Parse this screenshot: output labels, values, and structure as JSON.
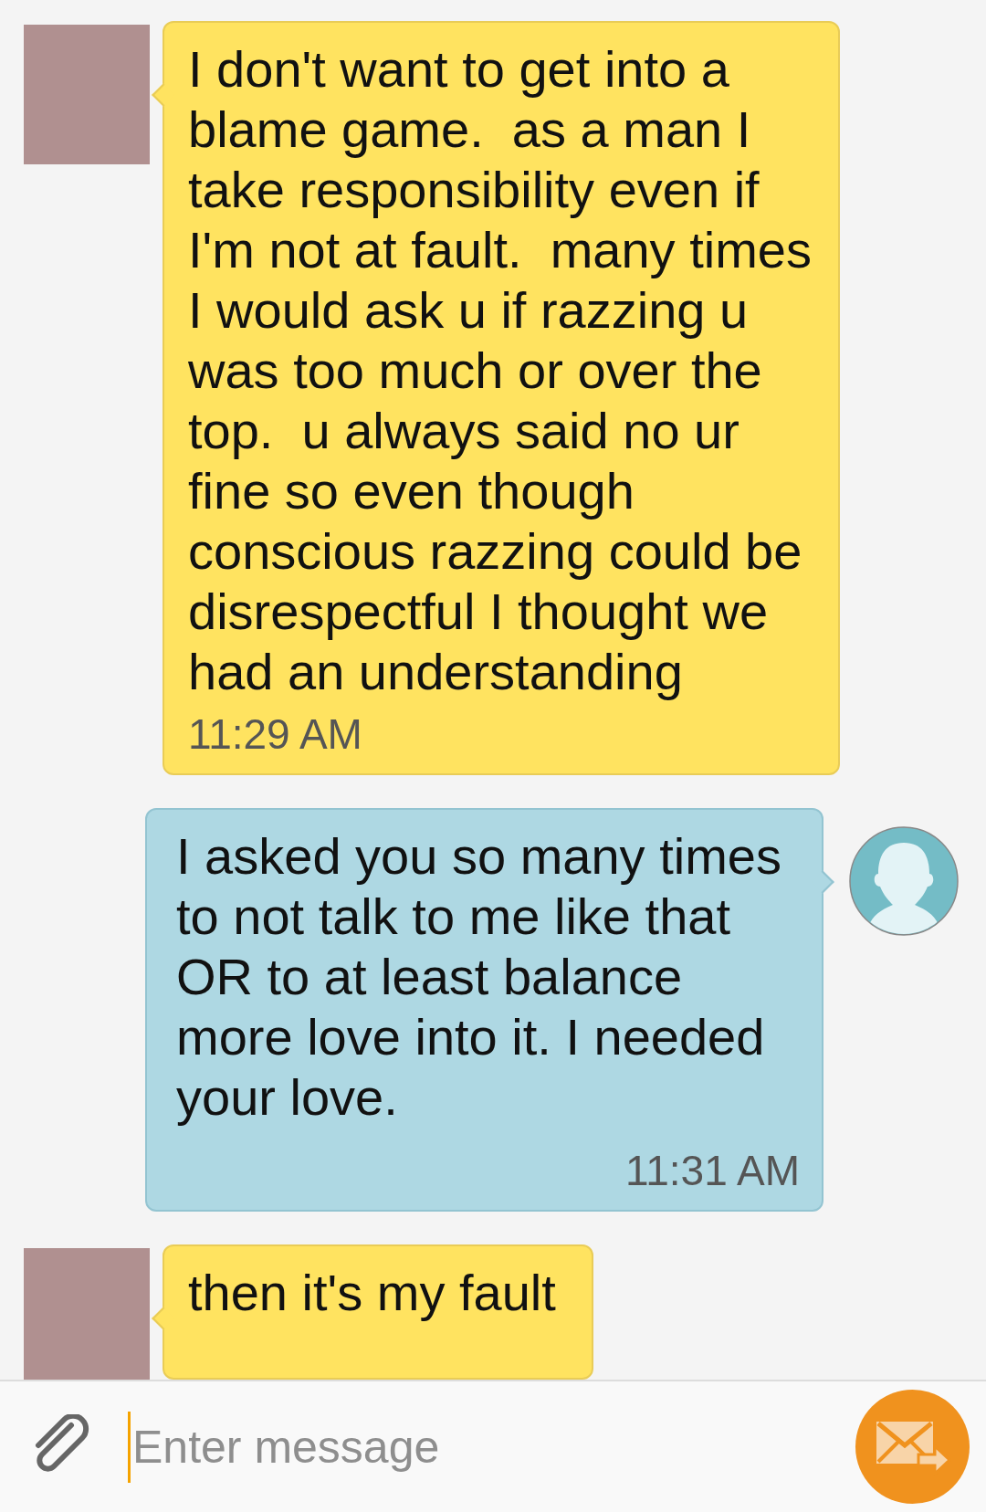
{
  "messages": [
    {
      "kind": "received",
      "text": "I don't want to get into a blame game.  as a man I take responsibility even if I'm not at fault.  many times I would ask u if razzing u was too much or over the top.  u always said no ur fine so even though conscious razzing could be disrespectful I thought we had an understanding",
      "time": "11:29 AM"
    },
    {
      "kind": "sent",
      "text": "I asked you so many times to not talk to me like that OR to at least balance more love into it. I needed your love.",
      "time": "11:31 AM"
    },
    {
      "kind": "received",
      "text": "then it's my fault"
    }
  ],
  "composer": {
    "placeholder": "Enter message"
  }
}
